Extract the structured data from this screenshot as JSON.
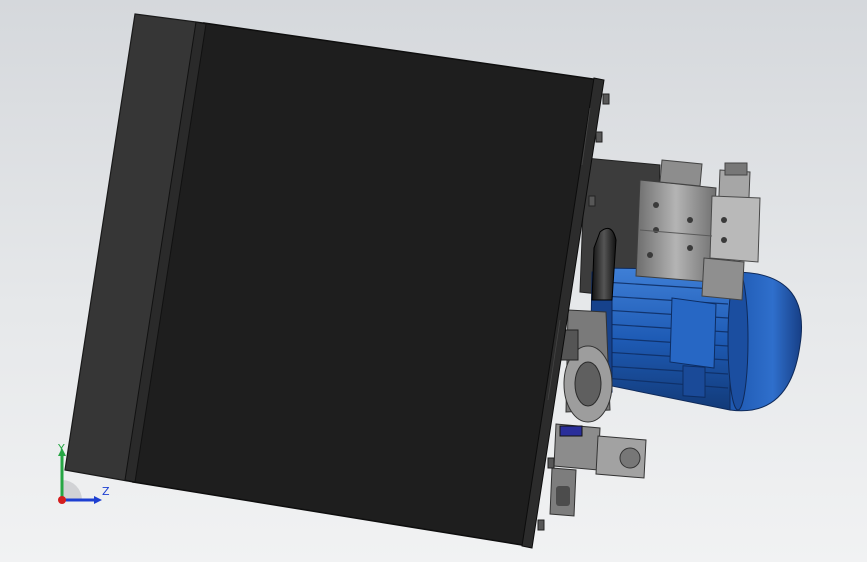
{
  "viewport": {
    "background_top": "#d5d8dc",
    "background_bottom": "#f1f2f3"
  },
  "model": {
    "tank_color": "#1e1e1e",
    "tank_side_color": "#363636",
    "motor_color": "#1e5bb5",
    "motor_dark_color": "#133d80",
    "valve_color": "#9a9a9a",
    "valve_dark_color": "#5e5e5e",
    "label_color": "#2a2e9a"
  },
  "triad": {
    "y_label": "Y",
    "z_label": "Z",
    "y_color": "#26a644",
    "z_color": "#1d3fd1",
    "x_color": "#d41e1e"
  }
}
